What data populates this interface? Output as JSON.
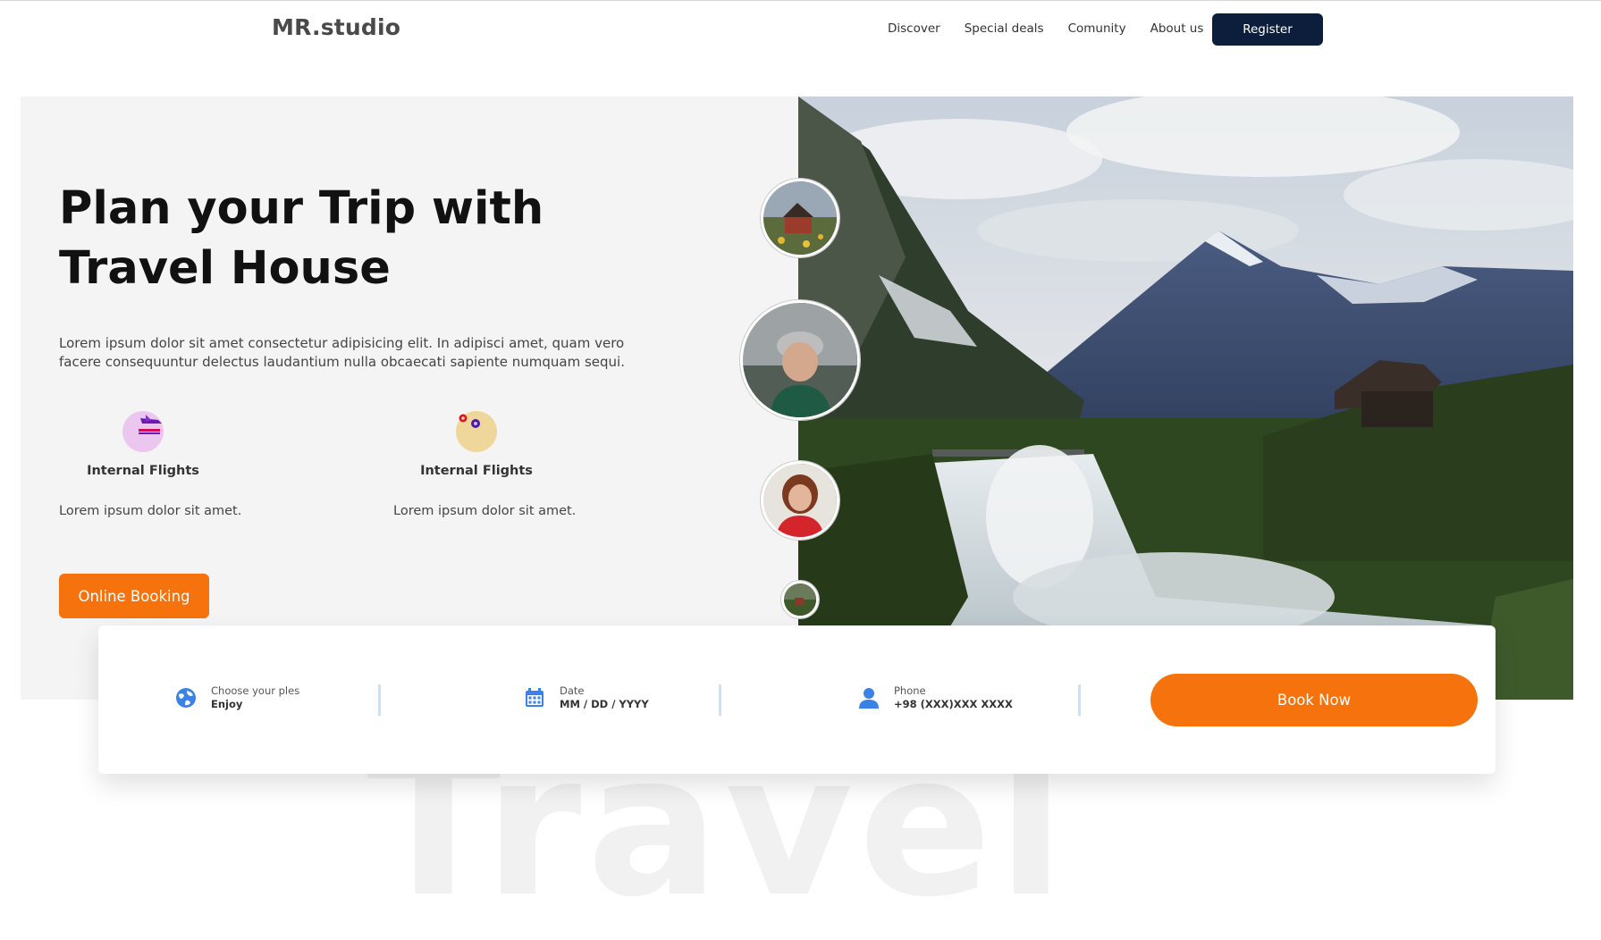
{
  "header": {
    "logo": "MR.studio",
    "nav": [
      "Discover",
      "Special deals",
      "Comunity",
      "About us"
    ],
    "register_label": "Register"
  },
  "hero": {
    "title": "Plan your Trip with Travel House",
    "description": "Lorem ipsum dolor sit amet consectetur adipisicing elit. In adipisci amet, quam vero facere consequuntur delectus laudantium nulla obcaecati sapiente numquam sequi.",
    "features": [
      {
        "title": "Internal Flights",
        "text": "Lorem ipsum dolor sit amet.",
        "icon": "airplane-icon",
        "color": "#ebc7ef"
      },
      {
        "title": "Internal Flights",
        "text": "Lorem ipsum dolor sit amet.",
        "icon": "flower-icon",
        "color": "#efd79c"
      }
    ],
    "cta_label": "Online Booking"
  },
  "booking": {
    "fields": [
      {
        "label": "Choose your ples",
        "value": "Enjoy",
        "icon": "globe-icon"
      },
      {
        "label": "Date",
        "value": "MM / DD / YYYY",
        "icon": "calendar-icon"
      },
      {
        "label": "Phone",
        "value": "+98 (XXX)XXX XXXX",
        "icon": "user-icon"
      }
    ],
    "button_label": "Book Now"
  },
  "watermark": "Travel",
  "colors": {
    "accent": "#f5720c",
    "dark": "#0d1e3d",
    "icon_blue": "#3b82e6",
    "hero_bg": "#f4f4f4"
  }
}
